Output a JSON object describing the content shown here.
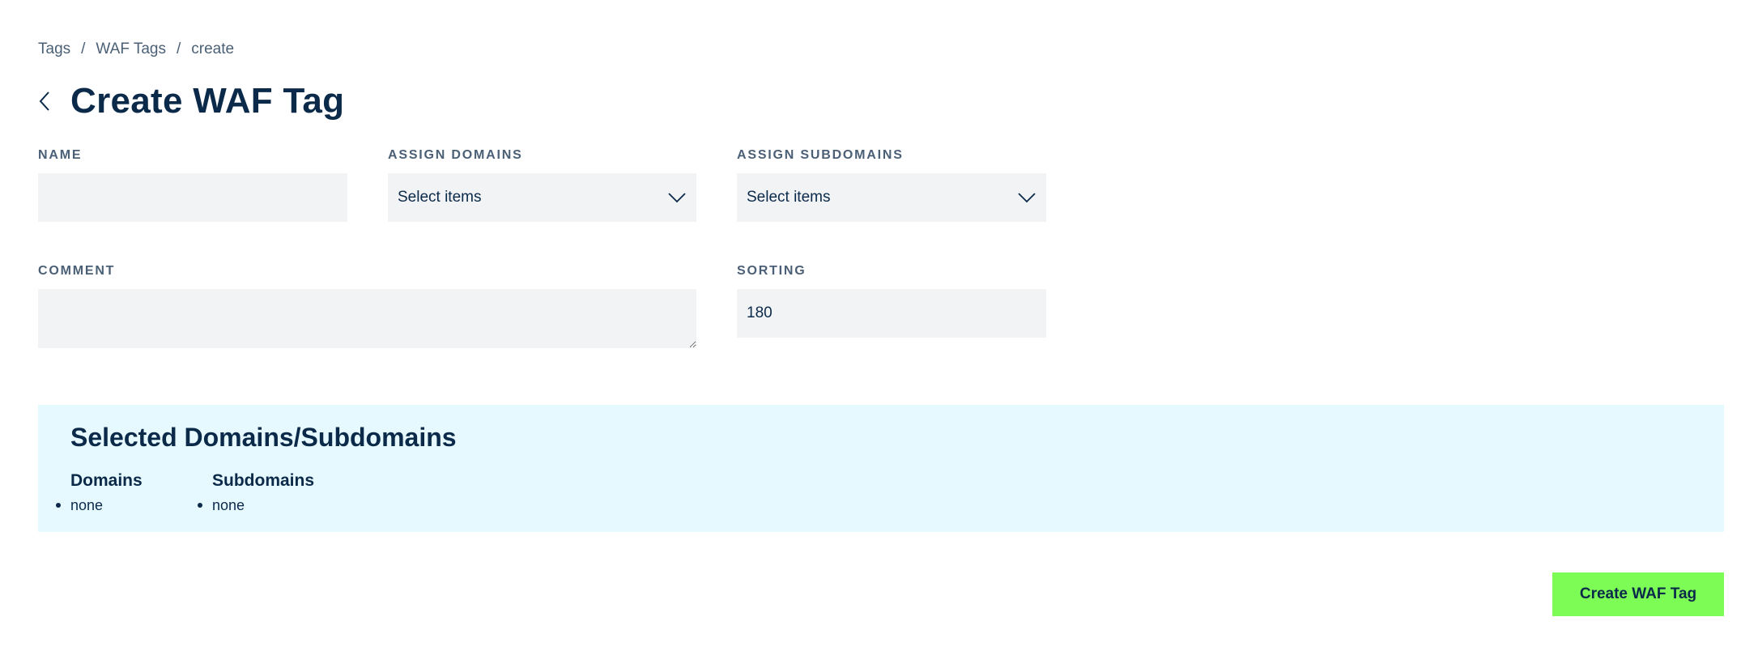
{
  "breadcrumb": {
    "items": [
      "Tags",
      "WAF Tags",
      "create"
    ],
    "separator": "/"
  },
  "header": {
    "title": "Create WAF Tag",
    "back_icon": "chevron-left-icon"
  },
  "form": {
    "name": {
      "label": "NAME",
      "value": "",
      "placeholder": ""
    },
    "assign_domains": {
      "label": "ASSIGN DOMAINS",
      "value": "Select items",
      "icon": "chevron-down-icon"
    },
    "assign_subdomains": {
      "label": "ASSIGN SUBDOMAINS",
      "value": "Select items",
      "icon": "chevron-down-icon"
    },
    "comment": {
      "label": "COMMENT",
      "value": ""
    },
    "sorting": {
      "label": "SORTING",
      "value": "180"
    }
  },
  "selected": {
    "title": "Selected Domains/Subdomains",
    "domains": {
      "heading": "Domains",
      "items": [
        "none"
      ]
    },
    "subdomains": {
      "heading": "Subdomains",
      "items": [
        "none"
      ]
    }
  },
  "actions": {
    "create_label": "Create WAF Tag"
  },
  "colors": {
    "text": "#0b2a4a",
    "muted": "#4b6076",
    "input_bg": "#f1f3f4",
    "panel_bg": "#e6f9fe",
    "primary_button": "#7cfc55"
  }
}
